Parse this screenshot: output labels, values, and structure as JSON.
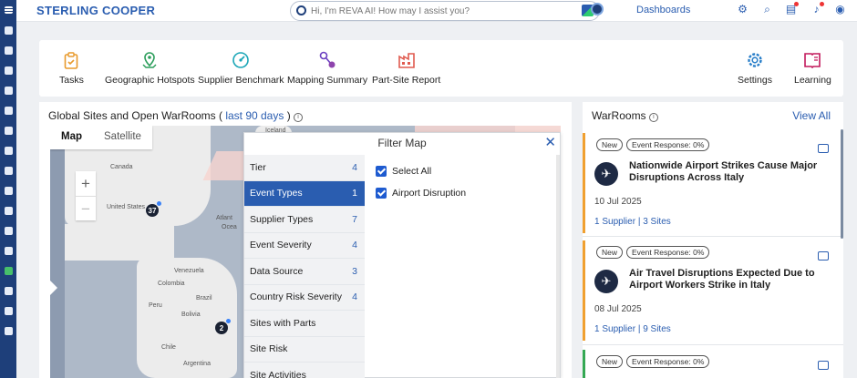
{
  "app": {
    "brand": "STERLING COOPER"
  },
  "search": {
    "placeholder": "Hi, I'm REVA AI! How may I assist you?"
  },
  "header": {
    "dashboards_label": "Dashboards"
  },
  "toolbar": {
    "items": [
      {
        "label": "Tasks",
        "icon": "clipboard-icon"
      },
      {
        "label": "Geographic Hotspots",
        "icon": "map-pin-icon"
      },
      {
        "label": "Supplier Benchmark",
        "icon": "gauge-icon"
      },
      {
        "label": "Mapping Summary",
        "icon": "mapping-icon"
      },
      {
        "label": "Part-Site Report",
        "icon": "factory-icon"
      },
      {
        "label": "Settings",
        "icon": "gear-icon"
      },
      {
        "label": "Learning",
        "icon": "book-icon"
      }
    ]
  },
  "map_panel": {
    "title": "Global Sites and Open WarRooms (",
    "link": "last 90 days",
    "title_end": ")",
    "map_types": [
      "Map",
      "Satellite"
    ],
    "labels": [
      "Iceland",
      "Canada",
      "United States",
      "Atlant",
      "Ocea",
      "Venezuela",
      "Colombia",
      "Peru",
      "Brazil",
      "Bolivia",
      "Chile",
      "Argentina"
    ],
    "clusters": [
      "37",
      "2"
    ]
  },
  "filter": {
    "title": "Filter Map",
    "categories": [
      {
        "label": "Tier",
        "count": "4"
      },
      {
        "label": "Event Types",
        "count": "1"
      },
      {
        "label": "Supplier Types",
        "count": "7"
      },
      {
        "label": "Event Severity",
        "count": "4"
      },
      {
        "label": "Data Source",
        "count": "3"
      },
      {
        "label": "Country Risk Severity",
        "count": "4"
      },
      {
        "label": "Sites with Parts",
        "count": ""
      },
      {
        "label": "Site Risk",
        "count": ""
      },
      {
        "label": "Site Activities",
        "count": ""
      }
    ],
    "options": [
      "Select All",
      "Airport Disruption"
    ]
  },
  "warrooms": {
    "title": "WarRooms",
    "view_all": "View All",
    "cards": [
      {
        "tag_new": "New",
        "tag_response": "Event Response: 0%",
        "title": "Nationwide Airport Strikes Cause Major Disruptions Across Italy",
        "date": "10 Jul 2025",
        "suppliers": "1 Supplier",
        "sites": "3 Sites"
      },
      {
        "tag_new": "New",
        "tag_response": "Event Response: 0%",
        "title": "Air Travel Disruptions Expected Due to Airport Workers Strike in Italy",
        "date": "08 Jul 2025",
        "suppliers": "1 Supplier",
        "sites": "9 Sites"
      },
      {
        "tag_new": "New",
        "tag_response": "Event Response: 0%",
        "title": "",
        "date": "",
        "suppliers": "",
        "sites": ""
      }
    ]
  },
  "colors": {
    "brand": "#2a5db0",
    "rail": "#1e3f7a",
    "selected": "#2a5db0",
    "accent_orange": "#f0a030",
    "accent_green": "#34a853"
  }
}
